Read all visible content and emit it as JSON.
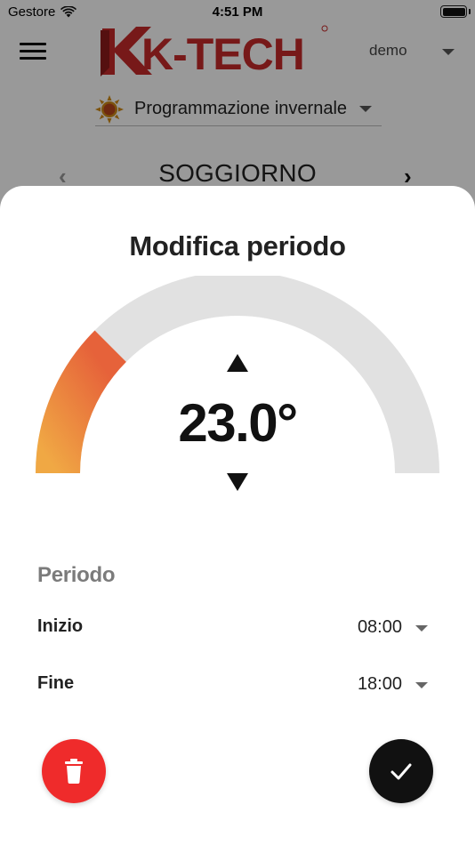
{
  "status_bar": {
    "carrier": "Gestore",
    "time": "4:51 PM"
  },
  "header": {
    "brand": "K-TECH",
    "user": "demo",
    "program": "Programmazione invernale"
  },
  "room_nav": {
    "room": "SOGGIORNO"
  },
  "sheet": {
    "title": "Modifica periodo",
    "temperature": "23.0°",
    "temperature_level_fraction": 0.25,
    "period_label": "Periodo",
    "start_label": "Inizio",
    "start_value": "08:00",
    "end_label": "Fine",
    "end_value": "18:00"
  },
  "colors": {
    "brand_red": "#c62a2a",
    "delete_button": "#ef2b2b",
    "confirm_button": "#111111",
    "gauge_track": "#e1e1e1",
    "gauge_fill_start": "#f0a844",
    "gauge_fill_end": "#e6623a"
  },
  "icons": {
    "menu": "menu-icon",
    "wifi": "wifi-icon",
    "battery": "battery-icon",
    "program": "sun-icon",
    "prev": "chevron-left-icon",
    "next": "chevron-right-icon",
    "delete": "trash-icon",
    "confirm": "check-icon"
  }
}
